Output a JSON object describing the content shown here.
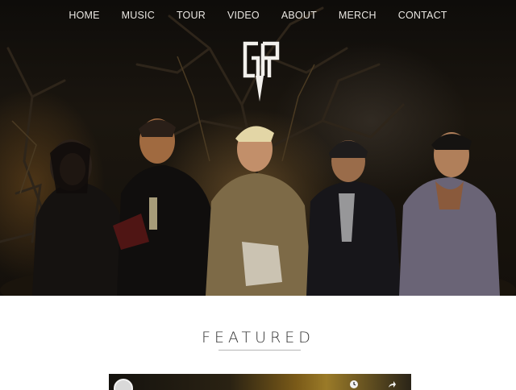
{
  "nav": {
    "items": [
      {
        "label": "HOME"
      },
      {
        "label": "MUSIC"
      },
      {
        "label": "TOUR"
      },
      {
        "label": "VIDEO"
      },
      {
        "label": "ABOUT"
      },
      {
        "label": "MERCH"
      },
      {
        "label": "CONTACT"
      }
    ]
  },
  "hero": {
    "logo_icon": "band-monogram-logo",
    "photo_subject": "band-photo"
  },
  "featured": {
    "title": "FEATURED",
    "video": {
      "title": "",
      "icons": [
        "clock-icon",
        "share-icon"
      ]
    }
  },
  "colors": {
    "nav_text": "#e9e6e1",
    "heading": "#333333",
    "rule": "#b5b5b5"
  }
}
